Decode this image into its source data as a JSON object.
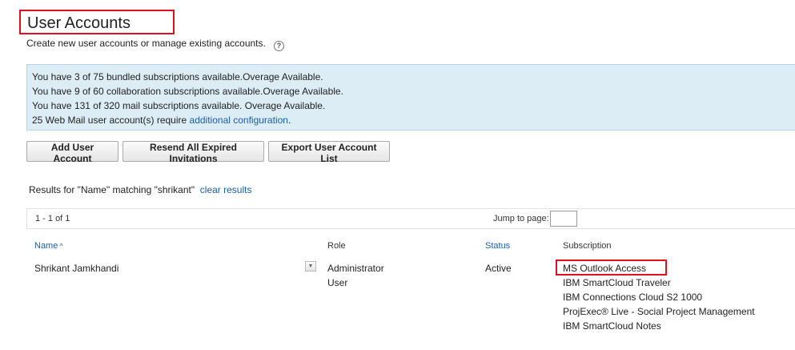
{
  "page": {
    "title": "User Accounts",
    "subtitle": "Create new user accounts or manage existing accounts.",
    "help_icon": "?"
  },
  "info": {
    "lines": [
      "You have 3 of 75 bundled subscriptions available.Overage Available.",
      "You have 9 of 60 collaboration subscriptions available.Overage Available.",
      "You have 131 of 320 mail subscriptions available. Overage Available."
    ],
    "webmail_prefix": "25 Web Mail user account(s) require ",
    "webmail_link": "additional configuration",
    "webmail_suffix": "."
  },
  "toolbar": {
    "add_label": "Add User Account",
    "resend_label": "Resend All Expired Invitations",
    "export_label": "Export User Account List"
  },
  "results": {
    "text": "Results for \"Name\" matching \"shrikant\"",
    "clear_label": "clear results"
  },
  "pager": {
    "range": "1 - 1 of 1",
    "jump_label": "Jump to page:",
    "jump_value": ""
  },
  "table": {
    "headers": {
      "name": "Name",
      "name_sort_icon": "^",
      "role": "Role",
      "status": "Status",
      "subscription": "Subscription"
    },
    "rows": [
      {
        "name": "Shrikant Jamkhandi",
        "menu_icon": "chevron-down-icon",
        "roles": [
          "Administrator",
          "User"
        ],
        "status": "Active",
        "subscriptions": [
          "MS Outlook Access",
          "IBM SmartCloud Traveler",
          "IBM Connections Cloud S2 1000",
          "ProjExec® Live - Social Project Management",
          "IBM SmartCloud Notes"
        ]
      }
    ]
  },
  "colors": {
    "highlight": "#e0111c",
    "link": "#1a5fa6",
    "info_bg": "#dcedf5"
  }
}
